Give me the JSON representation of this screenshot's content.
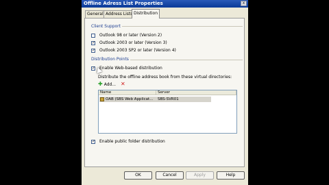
{
  "window": {
    "title": "Offline Adress List Properties",
    "close": "x"
  },
  "tabs": [
    {
      "label": "General"
    },
    {
      "label": "Address Lists"
    },
    {
      "label": "Distribution"
    }
  ],
  "client_support": {
    "label": "Client Support",
    "options": [
      {
        "label": "Outlook 98 or later (Version 2)",
        "checked": false
      },
      {
        "label": "Outlook 2003 or later (Version 3)",
        "checked": true
      },
      {
        "label": "Outlook 2003 SP2 or later (Version 4)",
        "checked": true
      }
    ]
  },
  "distribution_points": {
    "label": "Distribution Points",
    "enable_web": {
      "label": "Enable Web-based distribution",
      "checked": true
    },
    "description": "Distribute the offline address book from these virtual directories:",
    "add_label": "Add...",
    "columns": {
      "name": "Name",
      "server": "Server"
    },
    "rows": [
      {
        "name": "OAB (SBS Web Applicat...",
        "server": "SBS-SVR01"
      }
    ]
  },
  "public_folder": {
    "label": "Enable public folder distribution",
    "checked": true
  },
  "buttons": {
    "ok": "OK",
    "cancel": "Cancel",
    "apply": "Apply",
    "help": "Help"
  },
  "colors": {
    "title_bar": "#0a3a98",
    "accent_label": "#1b3c8f",
    "add_icon": "#2aa02a",
    "remove_icon": "#d02020"
  }
}
